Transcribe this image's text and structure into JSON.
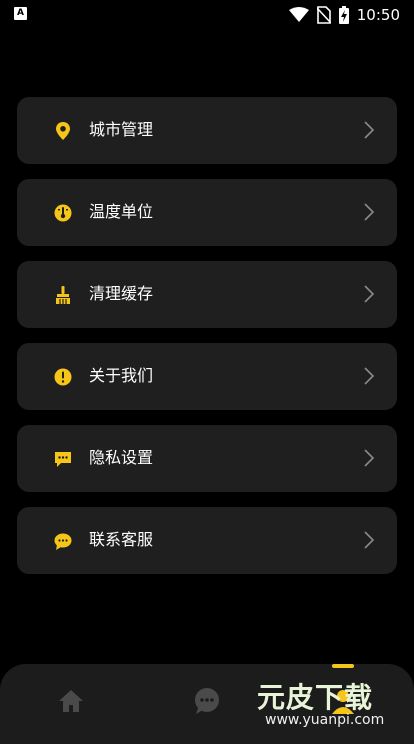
{
  "status_bar": {
    "app_icon": "A",
    "time": "10:50",
    "icons": [
      "wifi-icon",
      "no-sim-icon",
      "battery-charging-icon"
    ]
  },
  "menu": {
    "items": [
      {
        "label": "城市管理",
        "icon": "location-pin-icon"
      },
      {
        "label": "温度单位",
        "icon": "thermometer-dial-icon"
      },
      {
        "label": "清理缓存",
        "icon": "broom-icon"
      },
      {
        "label": "关于我们",
        "icon": "info-exclamation-icon"
      },
      {
        "label": "隐私设置",
        "icon": "privacy-chat-icon"
      },
      {
        "label": "联系客服",
        "icon": "customer-service-chat-icon"
      }
    ]
  },
  "bottom_nav": {
    "items": [
      {
        "name": "home",
        "icon": "home-icon"
      },
      {
        "name": "messages",
        "icon": "chat-bubble-icon"
      },
      {
        "name": "profile",
        "icon": "profile-icon",
        "active": true
      }
    ]
  },
  "watermark": {
    "title": "元皮下载",
    "url": "www.yuanpi.com"
  },
  "colors": {
    "accent": "#f5c518",
    "card": "#1f1f1f",
    "background": "#000000"
  }
}
